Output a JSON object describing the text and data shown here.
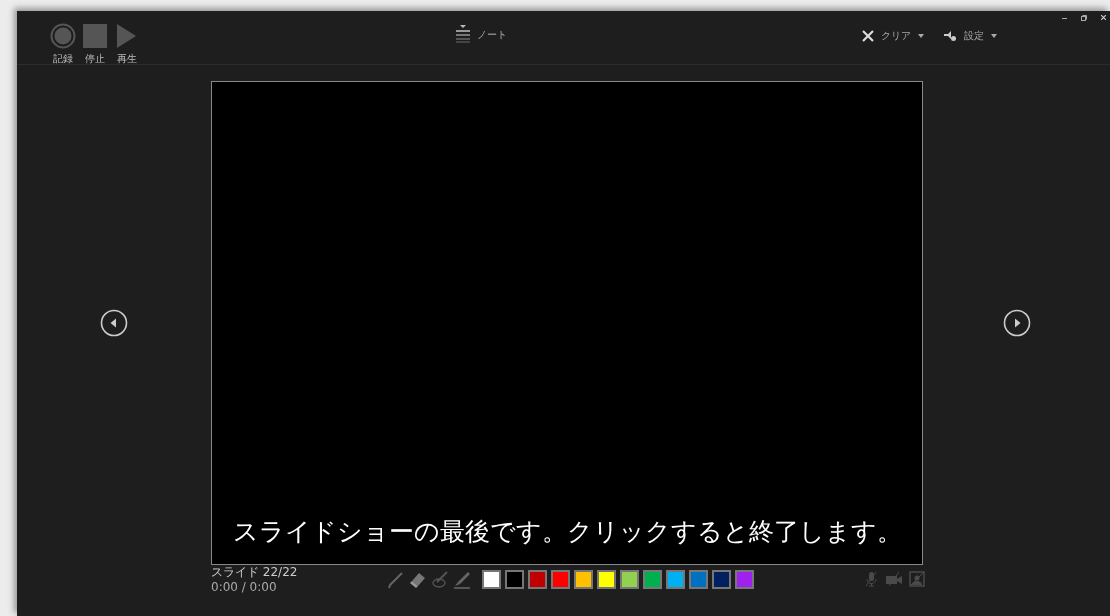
{
  "toolbar": {
    "recorder": [
      {
        "kind": "record",
        "label": "記録"
      },
      {
        "kind": "stop",
        "label": "停止"
      },
      {
        "kind": "play",
        "label": "再生"
      }
    ],
    "notes": {
      "label": "ノート"
    },
    "clear": {
      "label": "クリア"
    },
    "settings": {
      "label": "設定"
    }
  },
  "slide": {
    "message": "スライドショーの最後です。クリックすると終了します。"
  },
  "status": {
    "slide_counter": "スライド 22/22",
    "time": "0:00 / 0:00"
  },
  "ink_colors": [
    {
      "color": "#ffffff"
    },
    {
      "color": "#000000"
    },
    {
      "color": "#c00000"
    },
    {
      "color": "#ff0000"
    },
    {
      "color": "#ffc000"
    },
    {
      "color": "#ffff00"
    },
    {
      "color": "#92d050"
    },
    {
      "color": "#00b050"
    },
    {
      "color": "#00b0f0"
    },
    {
      "color": "#0070c0"
    },
    {
      "color": "#002060"
    },
    {
      "color": "#a020f0"
    }
  ]
}
